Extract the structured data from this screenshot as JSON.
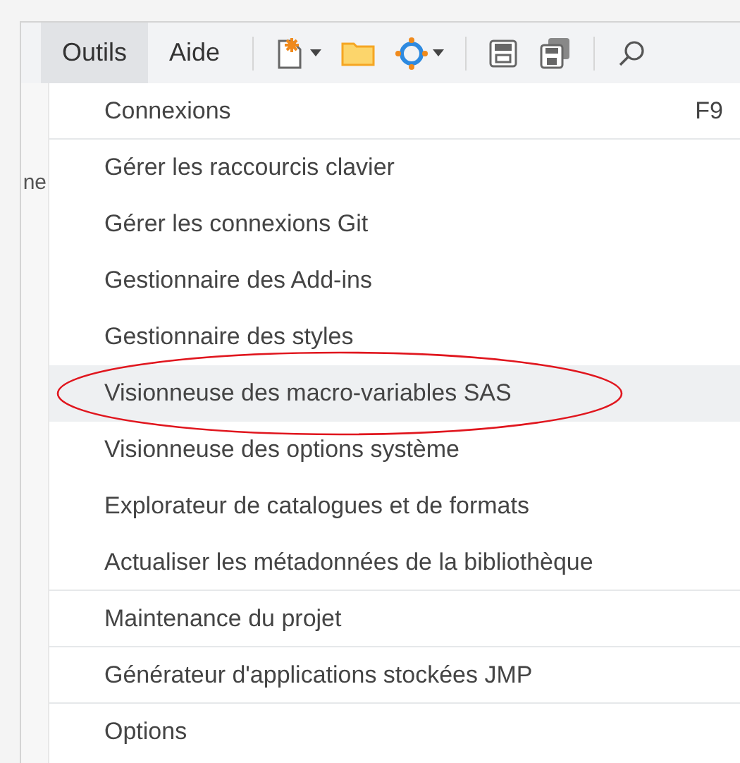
{
  "menubar": [
    {
      "label": "Outils",
      "selected": true
    },
    {
      "label": "Aide",
      "selected": false
    }
  ],
  "toolbar": [
    {
      "kind": "new",
      "caret": true
    },
    {
      "kind": "folder",
      "caret": false
    },
    {
      "kind": "gear",
      "caret": true
    },
    {
      "kind": "separator"
    },
    {
      "kind": "save",
      "caret": false
    },
    {
      "kind": "saveall",
      "caret": false
    },
    {
      "kind": "separator"
    },
    {
      "kind": "search",
      "caret": false
    }
  ],
  "background_text": "ne",
  "menu": [
    {
      "label": "Connexions",
      "shortcut": "F9",
      "highlighted": false,
      "circled": false,
      "separator_after": true
    },
    {
      "label": "Gérer les raccourcis clavier",
      "highlighted": false,
      "circled": false,
      "separator_after": false
    },
    {
      "label": "Gérer les connexions Git",
      "highlighted": false,
      "circled": false,
      "separator_after": false
    },
    {
      "label": "Gestionnaire des Add-ins",
      "highlighted": false,
      "circled": false,
      "separator_after": false
    },
    {
      "label": "Gestionnaire des styles",
      "highlighted": false,
      "circled": false,
      "separator_after": false
    },
    {
      "label": "Visionneuse des macro-variables SAS",
      "highlighted": true,
      "circled": true,
      "separator_after": false
    },
    {
      "label": "Visionneuse des options système",
      "highlighted": false,
      "circled": false,
      "separator_after": false
    },
    {
      "label": "Explorateur de catalogues et de formats",
      "highlighted": false,
      "circled": false,
      "separator_after": false
    },
    {
      "label": "Actualiser les métadonnées de la bibliothèque",
      "highlighted": false,
      "circled": false,
      "separator_after": true
    },
    {
      "label": "Maintenance du projet",
      "highlighted": false,
      "circled": false,
      "separator_after": true
    },
    {
      "label": "Générateur d'applications stockées JMP",
      "highlighted": false,
      "circled": false,
      "separator_after": true
    },
    {
      "label": "Options",
      "highlighted": false,
      "circled": false,
      "separator_after": false
    }
  ]
}
